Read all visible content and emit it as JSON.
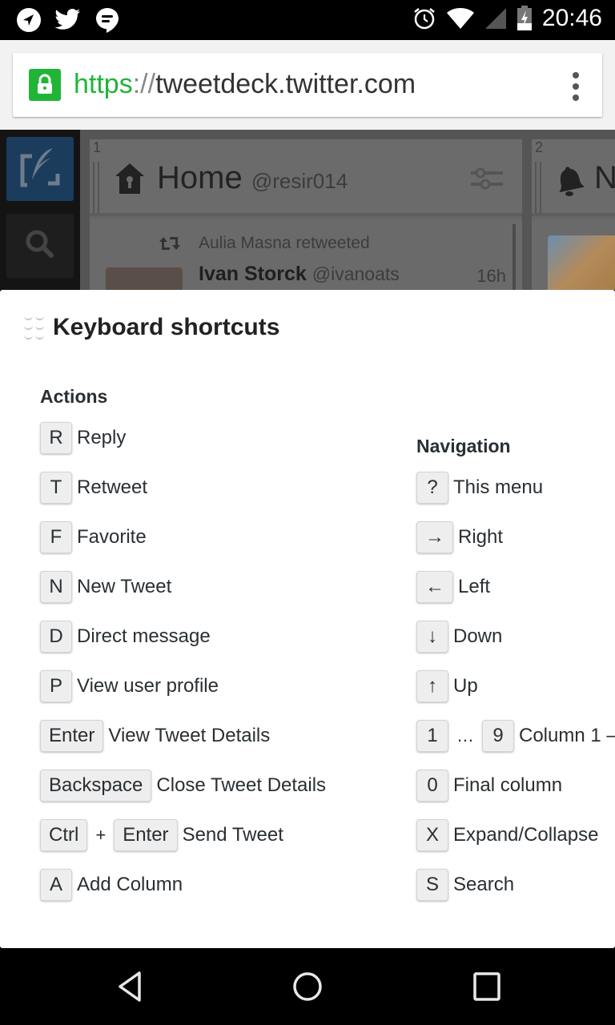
{
  "status_bar": {
    "left_icons": [
      "telegram-icon",
      "twitter-icon",
      "hangouts-icon"
    ],
    "right_icons": [
      "alarm-icon",
      "wifi-icon",
      "cell-signal-icon",
      "battery-charging-icon"
    ],
    "time": "20:46"
  },
  "browser": {
    "url_scheme": "https",
    "url_separator": "://",
    "url_host": "tweetdeck.twitter.com",
    "secure": true,
    "secure_color": "#21b537"
  },
  "background_app": {
    "columns": [
      {
        "number": "1",
        "icon": "home-icon",
        "title": "Home",
        "handle": "@resir014",
        "tweet": {
          "retweeted_by": "Aulia Masna retweeted",
          "author": "Ivan Storck",
          "author_handle": "@ivanoats",
          "time": "16h"
        }
      },
      {
        "number": "2",
        "icon": "bell-icon",
        "title": "N"
      }
    ]
  },
  "shortcuts": {
    "title": "Keyboard shortcuts",
    "actions": {
      "heading": "Actions",
      "items": [
        {
          "keys": [
            "R"
          ],
          "label": "Reply"
        },
        {
          "keys": [
            "T"
          ],
          "label": "Retweet"
        },
        {
          "keys": [
            "F"
          ],
          "label": "Favorite"
        },
        {
          "keys": [
            "N"
          ],
          "label": "New Tweet"
        },
        {
          "keys": [
            "D"
          ],
          "label": "Direct message"
        },
        {
          "keys": [
            "P"
          ],
          "label": "View user profile"
        },
        {
          "keys": [
            "Enter"
          ],
          "label": "View Tweet Details"
        },
        {
          "keys": [
            "Backspace"
          ],
          "label": "Close Tweet Details"
        },
        {
          "keys": [
            "Ctrl",
            "Enter"
          ],
          "joiner": "+",
          "label": "Send Tweet"
        },
        {
          "keys": [
            "A"
          ],
          "label": "Add Column"
        }
      ]
    },
    "navigation": {
      "heading": "Navigation",
      "items": [
        {
          "keys": [
            "?"
          ],
          "label": "This menu"
        },
        {
          "keys": [
            "→"
          ],
          "label": "Right"
        },
        {
          "keys": [
            "←"
          ],
          "label": "Left"
        },
        {
          "keys": [
            "↓"
          ],
          "label": "Down"
        },
        {
          "keys": [
            "↑"
          ],
          "label": "Up"
        },
        {
          "keys": [
            "1",
            "9"
          ],
          "joiner": "…",
          "label": "Column 1 —"
        },
        {
          "keys": [
            "0"
          ],
          "label": "Final column"
        },
        {
          "keys": [
            "X"
          ],
          "label": "Expand/Collapse"
        },
        {
          "keys": [
            "S"
          ],
          "label": "Search"
        }
      ]
    }
  },
  "nav_bar": {
    "buttons": [
      "back-icon",
      "home-circle-icon",
      "recents-icon"
    ]
  }
}
